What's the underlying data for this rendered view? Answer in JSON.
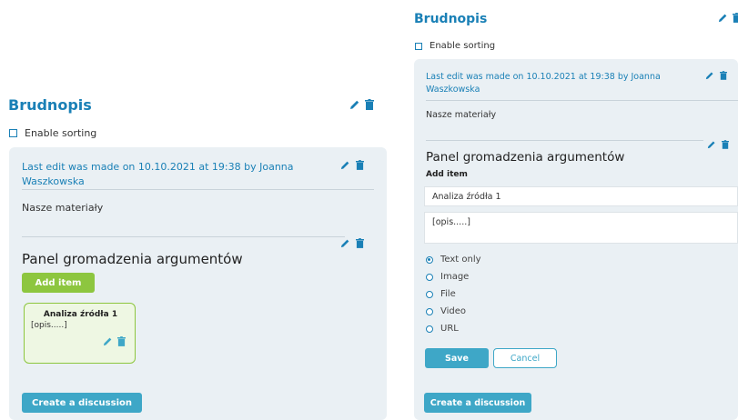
{
  "left": {
    "title": "Brudnopis",
    "enable_sorting": "Enable sorting",
    "last_edit": "Last edit was made on 10.10.2021 at 19:38 by Joanna Waszkowska",
    "materials": "Nasze materiały",
    "panel_title": "Panel gromadzenia argumentów",
    "add_item": "Add item",
    "item": {
      "title": "Analiza źródła 1",
      "desc": "[opis.....]"
    },
    "create_discussion": "Create a discussion"
  },
  "right": {
    "title": "Brudnopis",
    "enable_sorting": "Enable sorting",
    "last_edit": "Last edit was made on 10.10.2021 at 19:38 by Joanna Waszkowska",
    "materials": "Nasze materiały",
    "panel_title": "Panel gromadzenia argumentów",
    "add_item_label": "Add item",
    "title_value": "Analiza źródła 1",
    "desc_value": "[opis.....]",
    "types": [
      "Text only",
      "Image",
      "File",
      "Video",
      "URL"
    ],
    "selected_type": "Text only",
    "save": "Save",
    "cancel": "Cancel",
    "create_discussion": "Create a discussion"
  },
  "colors": {
    "title_blue": "#1a80b6",
    "card_bg": "#eaf0f4",
    "green": "#8dc63f",
    "button_blue": "#3ea7c7"
  }
}
